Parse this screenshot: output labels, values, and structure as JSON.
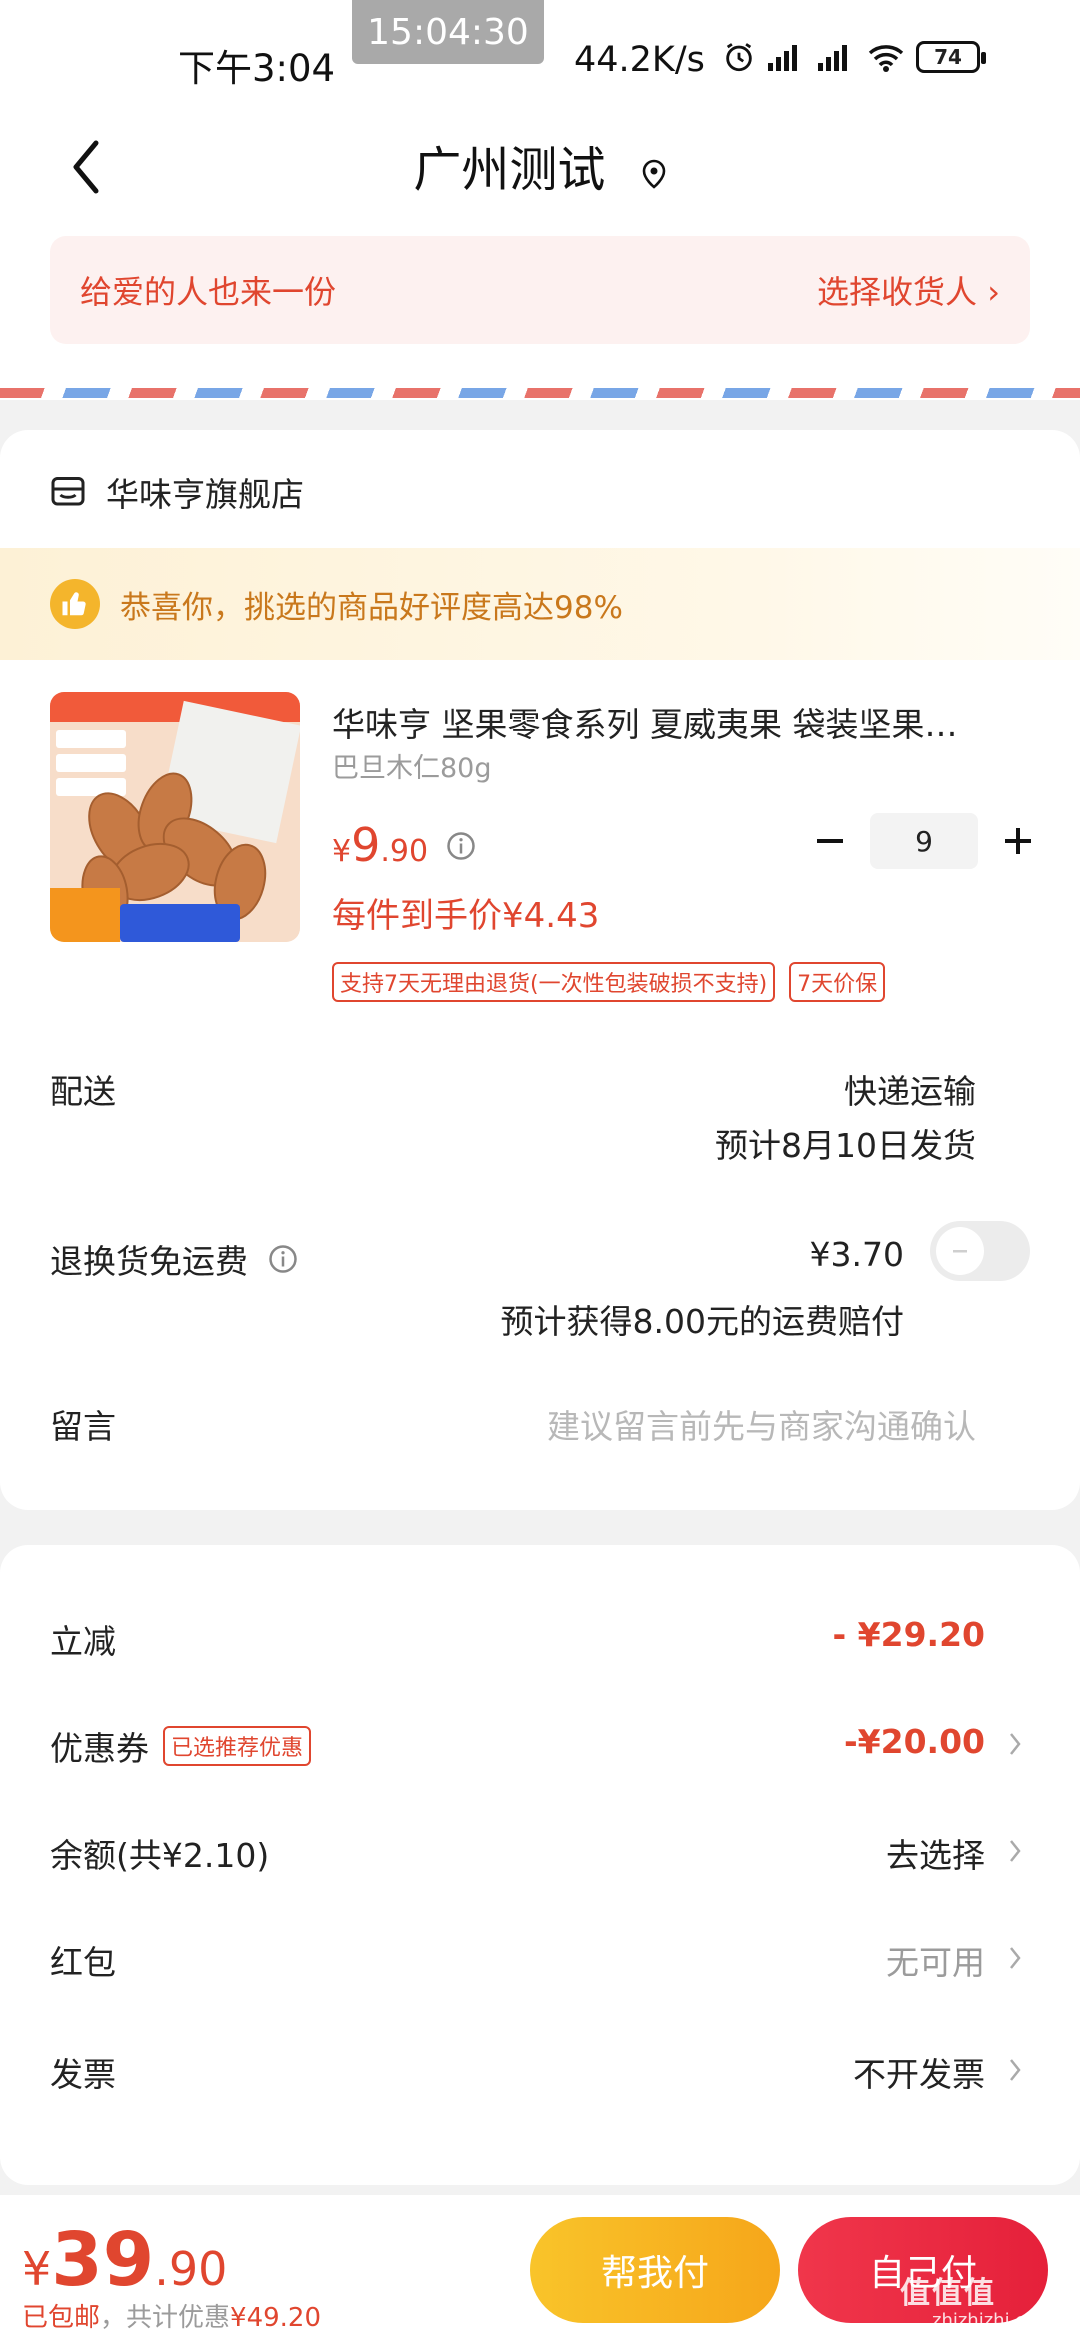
{
  "status_bar": {
    "time": "下午3:04",
    "clock": "15:04:30",
    "speed": "44.2K/s",
    "battery": "74"
  },
  "header": {
    "title": "广州测试"
  },
  "gift": {
    "left": "给爱的人也来一份",
    "right": "选择收货人 ›"
  },
  "store": {
    "name": "华味亨旗舰店",
    "praise": "恭喜你，挑选的商品好评度高达98%"
  },
  "product": {
    "name": "华味亨 坚果零食系列 夏威夷果 袋装坚果…",
    "spec": "巴旦木仁80g",
    "price_symbol": "¥",
    "price_int": "9",
    "price_dec": ".90",
    "quantity": "9",
    "unit_price": "每件到手价¥4.43",
    "tags": [
      "支持7天无理由退货(一次性包装破损不支持)",
      "7天价保"
    ]
  },
  "delivery": {
    "label": "配送",
    "method": "快递运输",
    "eta": "预计8月10日发货"
  },
  "return_insurance": {
    "label": "退换货免运费",
    "amount": "¥3.70",
    "note": "预计获得8.00元的运费赔付"
  },
  "message": {
    "label": "留言",
    "placeholder": "建议留言前先与商家沟通确认"
  },
  "discounts": [
    {
      "label": "立减",
      "value": "- ¥29.20"
    },
    {
      "label": "优惠券",
      "tag": "已选推荐优惠",
      "value": "-¥20.00"
    },
    {
      "label": "余额(共¥2.10)",
      "value": "去选择"
    },
    {
      "label": "红包",
      "value": "无可用"
    },
    {
      "label": "发票",
      "value": "不开发票"
    }
  ],
  "checkout": {
    "symbol": "¥",
    "int": "39",
    "dec": ".90",
    "shipping": "已包邮",
    "saved_prefix": "，共计优惠",
    "saved": "¥49.20",
    "help_pay": "帮我付",
    "self_pay": "自己付",
    "watermark": "值值值",
    "watermark_url": "zhizhizhi.com"
  }
}
